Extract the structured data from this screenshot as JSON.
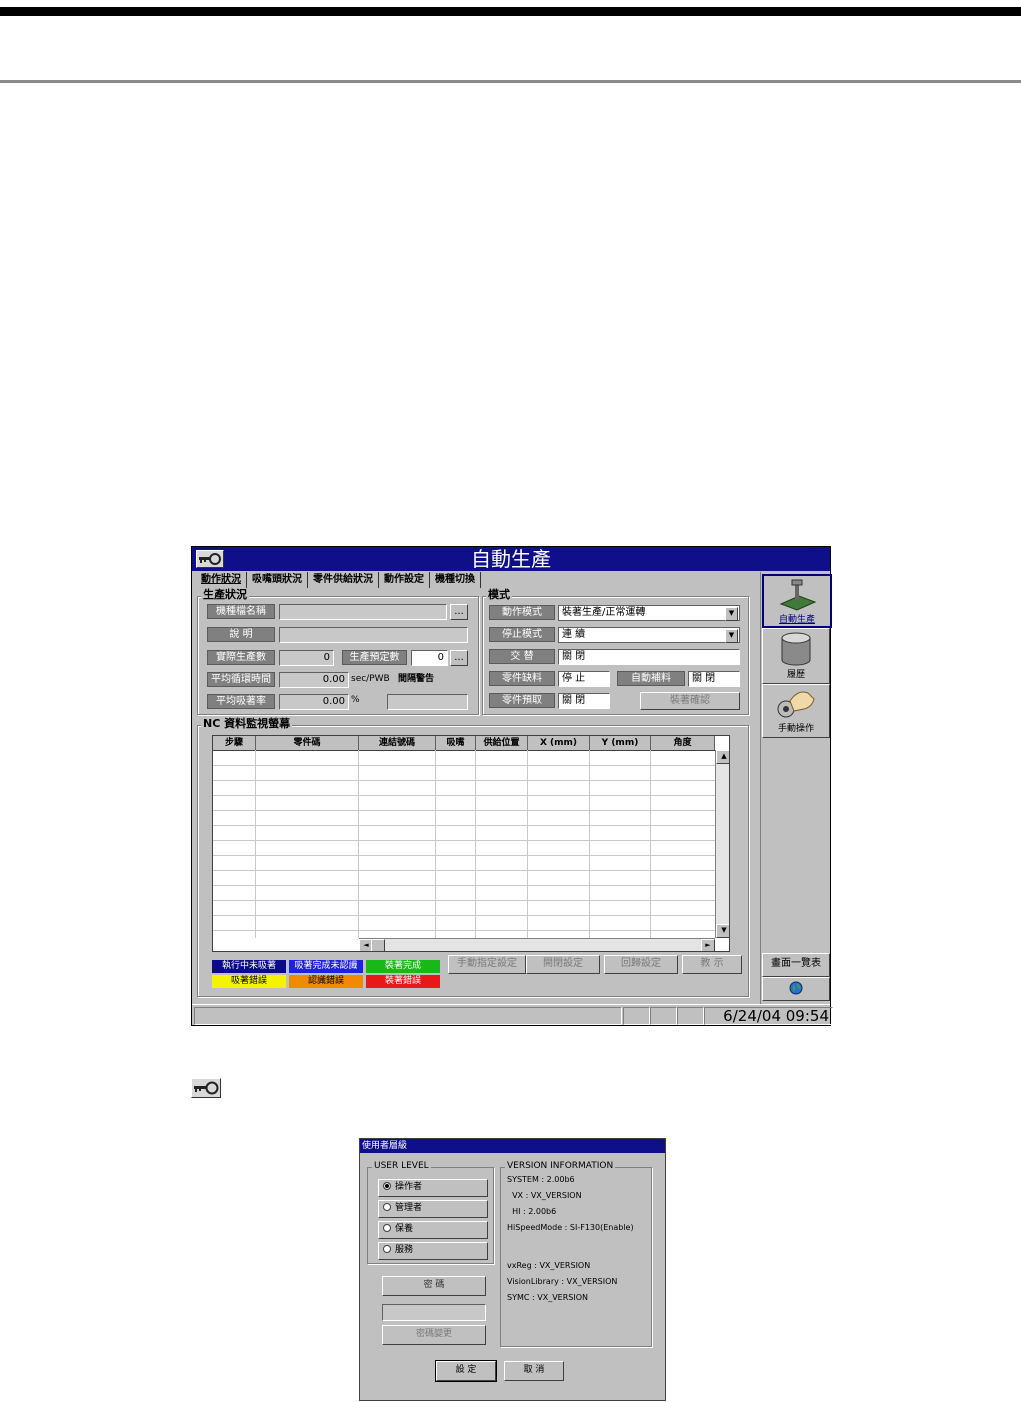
{
  "main_window": {
    "title": "自動生產",
    "tabs": [
      "動作狀況",
      "吸嘴頭狀況",
      "零件供給狀況",
      "動作設定",
      "機種切換"
    ],
    "production_status": {
      "group_label": "生產狀況",
      "name_label": "機種檔名稱",
      "name_value": "",
      "desc_label": "說 明",
      "desc_value": "",
      "actual_label": "實際生產數",
      "actual_value": "0",
      "planned_label": "生產預定數",
      "planned_value": "0",
      "cycle_label": "平均循環時間",
      "cycle_value": "0.00",
      "cycle_unit": "sec/PWB",
      "interval_warning": "間隔警告",
      "pickup_label": "平均吸著率",
      "pickup_value": "0.00",
      "pickup_unit": "%",
      "browse_btn": "..."
    },
    "mode": {
      "group_label": "模式",
      "op_mode_label": "動作模式",
      "op_mode_value": "裝著生產/正常運轉",
      "stop_mode_label": "停止模式",
      "stop_mode_value": "連 續",
      "alternate_label": "交 替",
      "alternate_value": "關 閉",
      "shortage_label": "零件缺料",
      "shortage_value": "停 止",
      "auto_refill_label": "自動補料",
      "auto_refill_value": "關 閉",
      "advance_label": "零件預取",
      "advance_value": "關 閉",
      "confirm_btn": "裝著確認"
    },
    "nc_monitor": {
      "group_label": "NC 資料監視螢幕",
      "columns": [
        "步驟",
        "零件碼",
        "連結號碼",
        "吸嘴",
        "供給位置",
        "X (mm)",
        "Y (mm)",
        "角度"
      ],
      "empty_rows": 12,
      "up_arrow": "▲",
      "down_arrow": "▼",
      "left_arrow": "◄",
      "right_arrow": "►"
    },
    "legend": [
      {
        "label": "執行中未吸著",
        "bg": "#0a0a8a",
        "fg": "#ffffff"
      },
      {
        "label": "吸著完成未認識",
        "bg": "#2020e0",
        "fg": "#ffffff"
      },
      {
        "label": "裝著完成",
        "bg": "#18b818",
        "fg": "#ffffff"
      },
      {
        "label": "吸著錯誤",
        "bg": "#f4f400",
        "fg": "#000000"
      },
      {
        "label": "認識錯誤",
        "bg": "#f08a00",
        "fg": "#000000"
      },
      {
        "label": "裝著錯誤",
        "bg": "#e81818",
        "fg": "#ffffff"
      }
    ],
    "action_buttons": [
      "手動指定設定",
      "開閉設定",
      "回歸設定",
      "教 示"
    ],
    "side_panel": {
      "auto_label": "自動生產",
      "history_label": "履歷",
      "manual_label": "手動操作",
      "screen_list_label": "畫面一覽表"
    },
    "status_bar": {
      "datetime": "6/24/04 09:54"
    }
  },
  "dialog": {
    "title": "使用者層級",
    "user_level_label": "USER LEVEL",
    "levels": [
      "操作者",
      "管理者",
      "保養",
      "服務"
    ],
    "selected_level": "操作者",
    "password_label": "密 碼",
    "password_value": "",
    "change_password_btn": "密碼變更",
    "version_label": "VERSION INFORMATION",
    "version_lines": [
      "SYSTEM : 2.00b6",
      "  VX : VX_VERSION",
      "  HI : 2.00b6",
      "HiSpeedMode : SI-F130(Enable)",
      "",
      "",
      "vxReg : VX_VERSION",
      "VisionLibrary : VX_VERSION",
      "SYMC : VX_VERSION"
    ],
    "ok_btn": "設 定",
    "cancel_btn": "取 消"
  },
  "colors": {
    "title_bar": "#0f0f8a",
    "window_bg": "#c0c0c0"
  }
}
